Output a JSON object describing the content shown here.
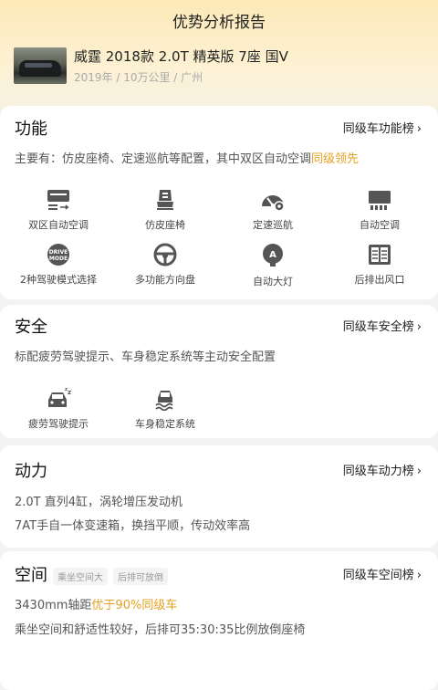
{
  "header": {
    "title": "优势分析报告",
    "car_name": "威霆 2018款 2.0T 精英版 7座 国V",
    "car_meta": "2019年 / 10万公里 / 广州"
  },
  "function_section": {
    "title": "功能",
    "rank_link": "同级车功能榜",
    "desc_prefix": "主要有：仿皮座椅、定速巡航等配置，其中双区自动空调",
    "desc_highlight": "同级领先",
    "features": [
      {
        "label": "双区自动空调",
        "icon": "dual-zone-ac-icon"
      },
      {
        "label": "仿皮座椅",
        "icon": "leather-seat-icon"
      },
      {
        "label": "定速巡航",
        "icon": "cruise-control-icon"
      },
      {
        "label": "自动空调",
        "icon": "auto-ac-icon"
      },
      {
        "label": "2种驾驶模式选择",
        "icon": "drive-mode-icon",
        "icon_text": "DRIVE MODE"
      },
      {
        "label": "多功能方向盘",
        "icon": "steering-wheel-icon"
      },
      {
        "label": "自动大灯",
        "icon": "auto-headlight-icon",
        "icon_text": "A"
      },
      {
        "label": "后排出风口",
        "icon": "rear-vent-icon"
      }
    ]
  },
  "safety_section": {
    "title": "安全",
    "rank_link": "同级车安全榜",
    "desc": "标配疲劳驾驶提示、车身稳定系统等主动安全配置",
    "features": [
      {
        "label": "疲劳驾驶提示",
        "icon": "fatigue-alert-icon"
      },
      {
        "label": "车身稳定系统",
        "icon": "stability-control-icon"
      }
    ]
  },
  "power_section": {
    "title": "动力",
    "rank_link": "同级车动力榜",
    "line1": "2.0T 直列4缸，涡轮增压发动机",
    "line2": "7AT手自一体变速箱，换挡平顺，传动效率高"
  },
  "space_section": {
    "title": "空间",
    "tags": [
      "乘坐空间大",
      "后排可放倒"
    ],
    "rank_link": "同级车空间榜",
    "line1_prefix": "3430mm轴距",
    "line1_highlight": "优于90%同级车",
    "line2": "乘坐空间和舒适性较好，后排可35:30:35比例放倒座椅"
  },
  "colors": {
    "highlight": "#e3a220",
    "icon": "#555555"
  }
}
